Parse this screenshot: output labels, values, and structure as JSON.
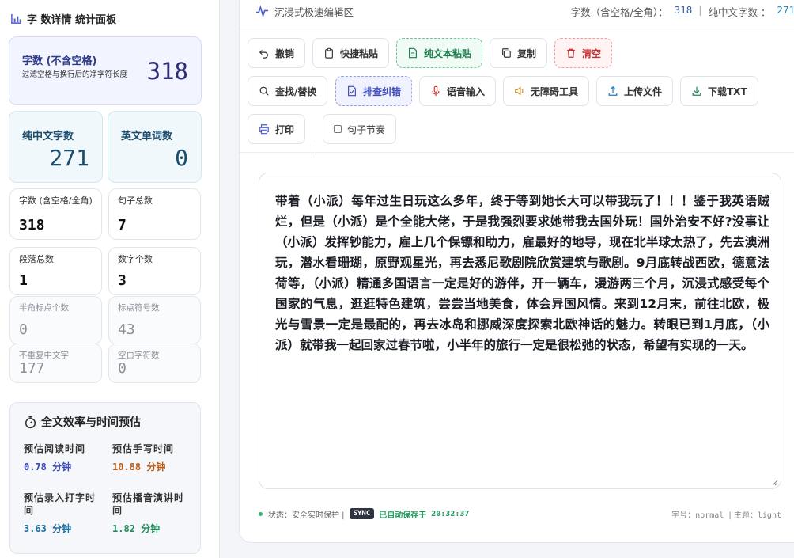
{
  "sidebar": {
    "title": "字 数详情 统计面板",
    "main_card": {
      "label": "字数 (不含空格)",
      "sub": "过滤空格与换行后的净字符长度",
      "value": "318"
    },
    "cn_chars": {
      "label": "纯中文字数",
      "value": "271"
    },
    "en_words": {
      "label": "英文单词数",
      "value": "0"
    },
    "stats": [
      {
        "label": "字数 (含空格/全角)",
        "value": "318"
      },
      {
        "label": "句子总数",
        "value": "7"
      },
      {
        "label": "段落总数",
        "value": "1"
      },
      {
        "label": "数字个数",
        "value": "3"
      },
      {
        "label": "半角标点个数",
        "value": "0"
      },
      {
        "label": "标点符号数",
        "value": "43"
      },
      {
        "label": "不重复中文字",
        "value": "177"
      },
      {
        "label": "空白字符数",
        "value": "0"
      }
    ],
    "efficiency": {
      "title": "全文效率与时间预估",
      "items": [
        {
          "label": "预估阅读时间",
          "value": "0.78 分钟",
          "color": "#3b48b8"
        },
        {
          "label": "预估手写时间",
          "value": "10.88 分钟",
          "color": "#c05a12"
        },
        {
          "label": "预估录入打字时间",
          "value": "3.63 分钟",
          "color": "#1d6fa0"
        },
        {
          "label": "预估播音演讲时间",
          "value": "1.82 分钟",
          "color": "#1f8a5a"
        }
      ]
    }
  },
  "topbar": {
    "title": "沉浸式极速编辑区",
    "count_label": "字数（含空格/全角）：",
    "count_value": "318",
    "sep": "|",
    "cn_label": "纯中文字数 ：",
    "cn_value": "271"
  },
  "toolbar": {
    "undo": "撤销",
    "quick_paste": "快捷粘贴",
    "plain_paste": "纯文本粘贴",
    "copy": "复制",
    "clear": "清空",
    "find_replace": "查找/替换",
    "proofread": "排查纠错",
    "voice_input": "语音输入",
    "accessibility": "无障碍工具",
    "upload": "上传文件",
    "download": "下载TXT",
    "print": "打印",
    "sentence_rhythm": "句子节奏"
  },
  "editor": {
    "text": "带着（小派）每年过生日玩这么多年，终于等到她长大可以带我玩了！！！鉴于我英语贼烂，但是（小派）是个全能大佬，于是我强烈要求她带我去国外玩！国外治安不好?没事让（小派）发挥钞能力，雇上几个保镖和助力，雇最好的地导，现在北半球太热了，先去澳洲玩，潜水看珊瑚，原野观星光，再去悉尼歌剧院欣赏建筑与歌剧。9月底转战西欧，德意法荷等，（小派）精通多国语言一定是好的游伴，开一辆车，漫游两三个月，沉浸式感受每个国家的气息，逛逛特色建筑，尝尝当地美食，体会异国风情。来到12月末，前往北欧，极光与雪景一定是最配的，再去冰岛和挪威深度探索北欧神话的魅力。转眼已到1月底，（小派）就带我一起回家过春节啦，小半年的旅行一定是很松弛的状态，希望有实现的一天。"
  },
  "status": {
    "state": "状态：安全实时保护 |",
    "sync": "SYNC",
    "saved_label": "已自动保存于",
    "saved_time": "20:32:37",
    "font_label": "字号：",
    "font_value": "normal",
    "theme_label": "| 主题：",
    "theme_value": "light"
  }
}
